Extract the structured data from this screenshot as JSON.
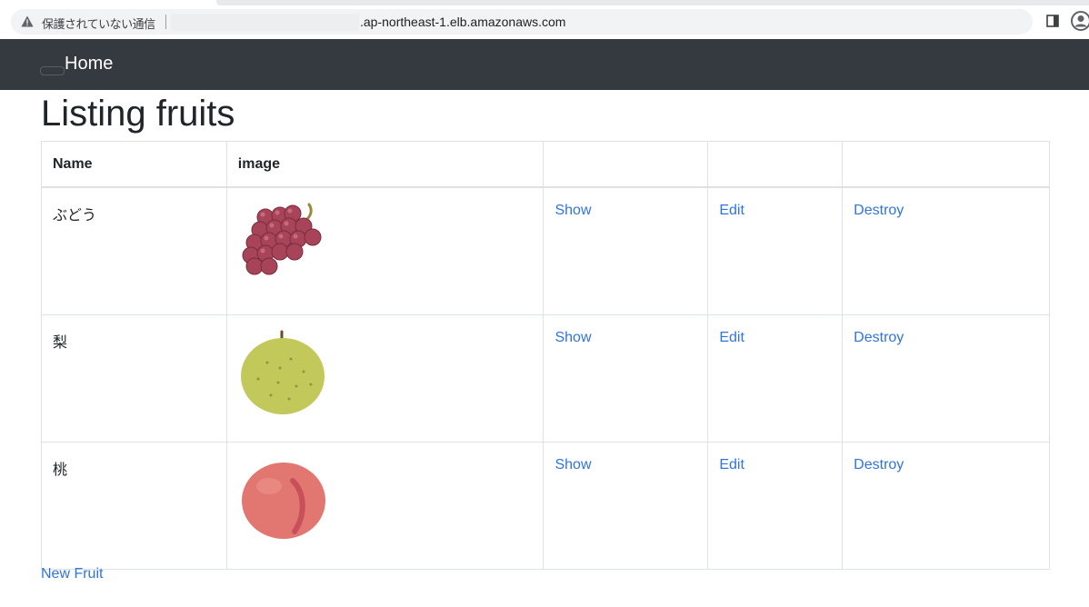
{
  "browser": {
    "security_label": "保護されていない通信",
    "url": ".ap-northeast-1.elb.amazonaws.com",
    "icons": [
      "warning-icon",
      "side-panel-icon",
      "profile-icon"
    ]
  },
  "navbar": {
    "home_label": "Home",
    "background": "#343a40"
  },
  "page": {
    "title": "Listing fruits",
    "new_link": "New Fruit"
  },
  "table": {
    "headers": [
      "Name",
      "image",
      "",
      "",
      ""
    ],
    "rows": [
      {
        "name": "ぶどう",
        "image": "grape",
        "show": "Show",
        "edit": "Edit",
        "destroy": "Destroy"
      },
      {
        "name": "梨",
        "image": "pear",
        "show": "Show",
        "edit": "Edit",
        "destroy": "Destroy"
      },
      {
        "name": "桃",
        "image": "peach",
        "show": "Show",
        "edit": "Edit",
        "destroy": "Destroy"
      }
    ]
  },
  "colors": {
    "link": "#2f74e0",
    "border": "#dee2e6"
  }
}
